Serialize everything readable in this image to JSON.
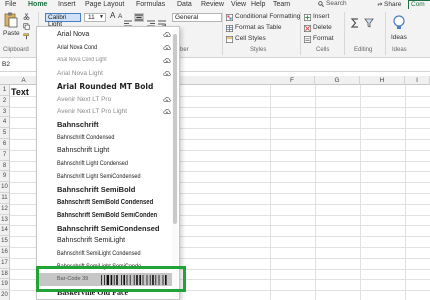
{
  "menu": {
    "items": [
      "File",
      "Home",
      "Insert",
      "Page Layout",
      "Formulas",
      "Data",
      "Review",
      "View",
      "Help",
      "Team"
    ],
    "active": "Home",
    "search_label": "Search",
    "share_label": "Share",
    "comments_label": "Com"
  },
  "ribbon": {
    "font_name": "Calibri Light",
    "font_size": "11",
    "number_format": "General",
    "paste_label": "Paste",
    "clipboard_label": "Clipboard",
    "number_group_label": "ber",
    "styles_group_label": "Styles",
    "cells_group_label": "Cells",
    "editing_group_label": "Editing",
    "ideas_group_label": "Ideas",
    "ideas_button": "Ideas",
    "conditional_formatting": "Conditional Formatting",
    "format_as_table": "Format as Table",
    "cell_styles": "Cell Styles",
    "insert": "Insert",
    "delete": "Delete",
    "format": "Format"
  },
  "formula_bar": {
    "name_box": "B2"
  },
  "grid": {
    "col_letters": [
      "A",
      "F",
      "G",
      "H",
      "I"
    ],
    "row_numbers": [
      "1",
      "2",
      "3",
      "4",
      "5",
      "6",
      "7",
      "8",
      "9",
      "10",
      "11",
      "12",
      "13",
      "14",
      "15",
      "16",
      "17",
      "18",
      "19",
      "20",
      "21"
    ],
    "a1_text": "Text"
  },
  "font_dropdown": {
    "fonts": [
      {
        "name": "Arial Nova",
        "style": "normal",
        "cloud": true
      },
      {
        "name": "Arial Nova Cond",
        "style": "cond",
        "cloud": true
      },
      {
        "name": "Arial Nova Cond Light",
        "style": "condlight",
        "cloud": true
      },
      {
        "name": "Arial Nova Light",
        "style": "light",
        "cloud": true
      },
      {
        "name": "Arial Rounded MT Bold",
        "style": "bold",
        "cloud": false
      },
      {
        "name": "Avenir Next LT Pro",
        "style": "light",
        "cloud": true
      },
      {
        "name": "Avenir Next LT Pro Light",
        "style": "light",
        "cloud": true
      },
      {
        "name": "Bahnschrift",
        "style": "semibold",
        "cloud": false
      },
      {
        "name": "Bahnschrift Condensed",
        "style": "cond",
        "cloud": false
      },
      {
        "name": "Bahnschrift Light",
        "style": "normal",
        "cloud": false
      },
      {
        "name": "Bahnschrift Light Condensed",
        "style": "cond",
        "cloud": false
      },
      {
        "name": "Bahnschrift Light SemiCondensed",
        "style": "cond",
        "cloud": false
      },
      {
        "name": "Bahnschrift SemiBold",
        "style": "semibold",
        "cloud": false
      },
      {
        "name": "Bahnschrift SemiBold Condensed",
        "style": "boldcond",
        "cloud": false
      },
      {
        "name": "Bahnschrift SemiBold SemiConden",
        "style": "boldcond",
        "cloud": false
      },
      {
        "name": "Bahnschrift SemiCondensed",
        "style": "semibold",
        "cloud": false
      },
      {
        "name": "Bahnschrift SemiLight",
        "style": "normal",
        "cloud": false
      },
      {
        "name": "Bahnschrift SemiLight Condensed",
        "style": "cond",
        "cloud": false
      },
      {
        "name": "Bahnschrift SemiLight SemiConde",
        "style": "cond",
        "cloud": false
      },
      {
        "name": "Bar-Code 39",
        "style": "barcode",
        "cloud": false,
        "highlighted": true
      },
      {
        "name": "Baskerville Old Face",
        "style": "serif",
        "cloud": false
      }
    ]
  },
  "colors": {
    "accent": "#1d6f42",
    "highlight_box": "#21a336",
    "selected_item": "#c6c6c6"
  }
}
